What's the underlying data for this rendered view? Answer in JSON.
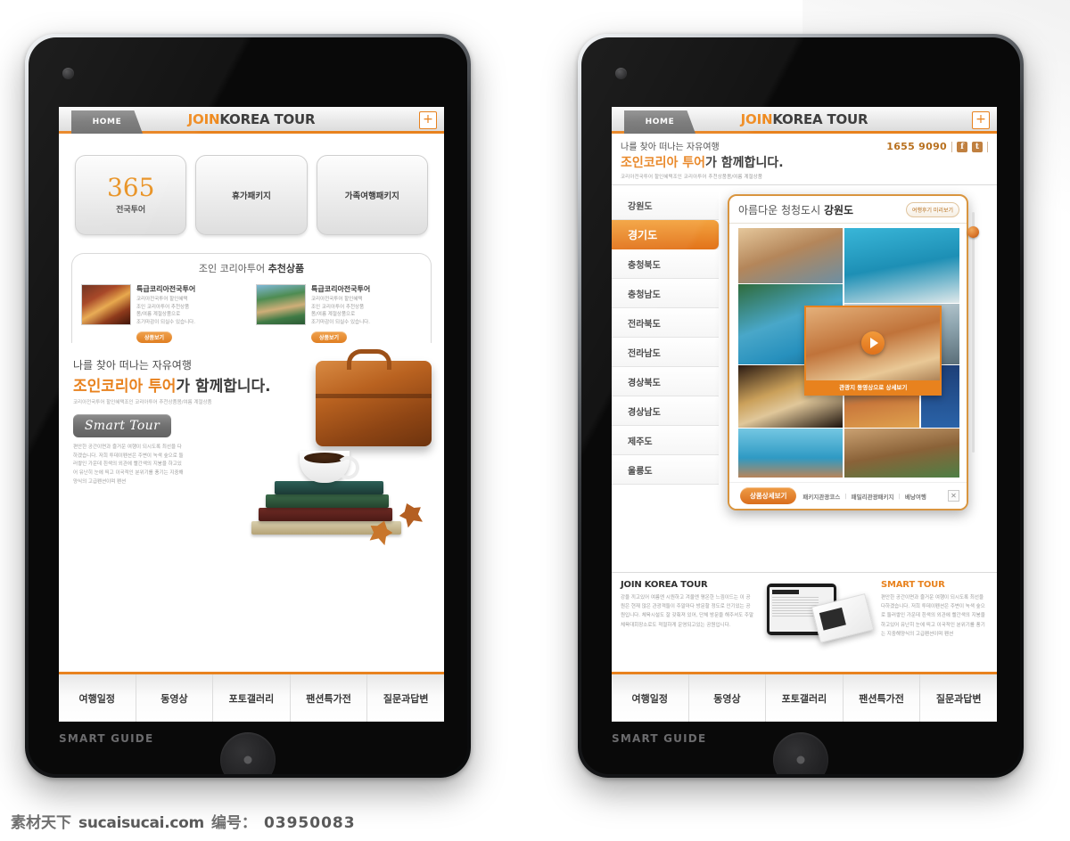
{
  "header": {
    "home_tab": "HOME",
    "brand_first": "JOIN",
    "brand_rest": "KOREA TOUR",
    "plus": "+"
  },
  "device": {
    "label": "SMART GUIDE"
  },
  "tablet1": {
    "categories": [
      {
        "big": "365",
        "sub": "전국투어"
      },
      {
        "label": "휴가패키지"
      },
      {
        "label": "가족여행패키지"
      }
    ],
    "recommend": {
      "title_normal": "조인 코리아투어 ",
      "title_bold": "추천상품",
      "items": [
        {
          "heading": "특급코리아전국투어",
          "body": "코리아전국투어 할인혜택\n조인 코리아투어 추천상품\n봄/여름 계절상품으로\n조기마감이 되실수 있습니다.",
          "button": "상품보기"
        },
        {
          "heading": "특급코리아전국투어",
          "body": "코리아전국투어 할인혜택\n조인 코리아투어 추천상품\n봄/여름 계절상품으로\n조기마감이 되실수 있습니다.",
          "button": "상품보기"
        }
      ]
    },
    "promo": {
      "line1": "나를 찾아 떠나는 자유여행",
      "line2_hl": "조인코리아 투어",
      "line2_rest": "가 함께합니다.",
      "line3": "코리아전국투어 할인혜택조인 코리아투어 추천상품봄/여름 계절상품",
      "button": "Smart Tour",
      "body": "편안한 공간이면과 즐거운 여행이 되시도록 최선을 다하겠습니다. 저희 투데이펜션은 주변이 녹색 숲으로 둘러쌓인 가운데 흰색의 외관에 빨간색의 지붕을 하고있어 유난히 눈에 띄고 이국적인 분위기를 풍기는 지중해양식의 고급펜션이며 펜션"
    }
  },
  "tablet2": {
    "sub_header": {
      "line1": "나를 찾아 떠나는 자유여행",
      "line2_hl": "조인코리아 투어",
      "line2_rest": "가 함께합니다.",
      "line3": "코리아전국투어 할인혜택조인 코리아투어 추천상품봄/여름 계절상품",
      "phone": "1655 9090",
      "social": [
        "f",
        "t"
      ]
    },
    "regions": [
      {
        "label": "강원도",
        "active": false
      },
      {
        "label": "경기도",
        "active": true
      },
      {
        "label": "충청북도",
        "active": false
      },
      {
        "label": "충청남도",
        "active": false
      },
      {
        "label": "전라북도",
        "active": false
      },
      {
        "label": "전라남도",
        "active": false
      },
      {
        "label": "경상북도",
        "active": false
      },
      {
        "label": "경상남도",
        "active": false
      },
      {
        "label": "제주도",
        "active": false
      },
      {
        "label": "울릉도",
        "active": false
      }
    ],
    "popup": {
      "title_normal": "아름다운 청청도시 ",
      "title_bold": "강원도",
      "preview_button": "여행후기 미리보기",
      "video_caption": "관광지 동영상으로 상세보기",
      "detail_button": "상품상세보기",
      "links": [
        "패키지관광코스",
        "패밀리관광패키지",
        "베낭여행"
      ],
      "separator": "|",
      "close": "✕"
    },
    "info": {
      "left_heading": "JOIN KOREA TOUR",
      "left_body": "강을 끼고있어 여름엔 시원하고 겨울엔 평온한 느낌이드는 이 공원은 현재 많은 관광객들이 주말마다 방문할 정도로 인기있는 공원입니다. 체육시설도 잘 갖춰져 있어, 단체 방문을 해주셔도 주말 체육대회장소로도 적절하게 운영되고있는 공원입니다.",
      "right_heading": "SMART TOUR",
      "right_body": "편안한 공간이면과 즐거운 여행이 되시도록 최선을 다하겠습니다. 저희 투데이펜션은 주변이 녹색 숲으로 둘러쌓인 가운데 흰색의 외관에 빨간색의 지붕을 하고있어 유난히 눈에 띄고 이국적인 분위기를 풍기는 지중해양식의 고급펜션이며 펜션"
    }
  },
  "tabbar": [
    {
      "label": "여행일정"
    },
    {
      "label": "동영상"
    },
    {
      "label": "포토갤러리"
    },
    {
      "label": "팬션특가전"
    },
    {
      "label": "질문과답변"
    }
  ],
  "watermark": {
    "brand": "素材天下",
    "domain": "sucaisucai.com",
    "id_label": "编号：",
    "id_value": "03950083"
  },
  "colors": {
    "accent_orange": "#e8821e",
    "brand_orange": "#ef8b20",
    "text_dark": "#3c3c3c",
    "phone_brown": "#b8701e"
  }
}
